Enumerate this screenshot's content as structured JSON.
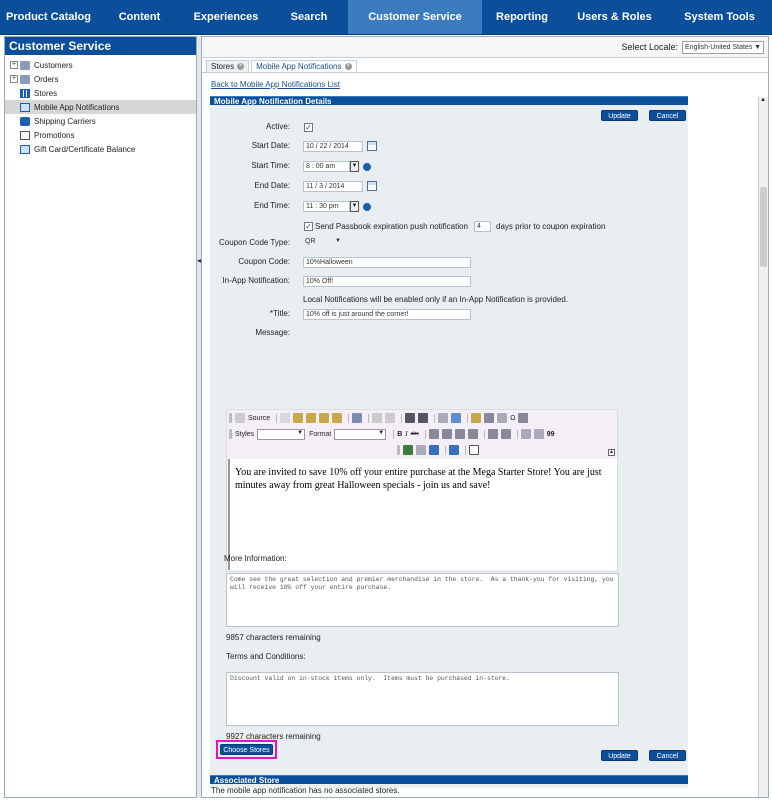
{
  "nav": {
    "items": [
      {
        "label": "Product Catalog"
      },
      {
        "label": "Content"
      },
      {
        "label": "Experiences"
      },
      {
        "label": "Search"
      },
      {
        "label": "Customer Service"
      },
      {
        "label": "Reporting"
      },
      {
        "label": "Users & Roles"
      },
      {
        "label": "System Tools"
      }
    ],
    "active": "Customer Service"
  },
  "sidebar": {
    "title": "Customer Service",
    "items": [
      {
        "label": "Customers",
        "icon": "folder-icon"
      },
      {
        "label": "Orders",
        "icon": "folder-icon"
      },
      {
        "label": "Stores",
        "icon": "store-icon"
      },
      {
        "label": "Mobile App Notifications",
        "icon": "mobile-icon"
      },
      {
        "label": "Shipping Carriers",
        "icon": "truck-icon"
      },
      {
        "label": "Promotions",
        "icon": "promotion-icon"
      },
      {
        "label": "Gift Card/Certificate Balance",
        "icon": "gift-card-icon"
      }
    ]
  },
  "locale": {
    "label": "Select Locale:",
    "value": "English-United States"
  },
  "tabs": [
    {
      "label": "Stores"
    },
    {
      "label": "Mobile App Notifications"
    }
  ],
  "back_link": "Back to Mobile App Notifications List",
  "details": {
    "title": "Mobile App Notification Details",
    "update": "Update",
    "cancel": "Cancel",
    "active_label": "Active:",
    "active_checked": "✓",
    "start_date_label": "Start Date:",
    "start_date": "10 / 22 / 2014",
    "start_time_label": "Start Time:",
    "start_time": "8 : 00  am",
    "end_date_label": "End Date:",
    "end_date": "11 / 3 / 2014",
    "end_time_label": "End Time:",
    "end_time": "11 : 30  pm",
    "passbook_label": "Send Passbook expiration push notification",
    "passbook_days": "4",
    "passbook_suffix": "days prior to coupon expiration",
    "coupon_type_label": "Coupon Code Type:",
    "coupon_type": "QR",
    "coupon_code_label": "Coupon Code:",
    "coupon_code": "10%Halloween",
    "inapp_label": "In-App Notification:",
    "inapp_value": "10% Off!",
    "local_note": "Local Notifications will be enabled only if an In-App Notification is provided.",
    "title_label": "*Title:",
    "title_value": "10% off is just around the corner!",
    "message_label": "Message:",
    "message_text": "You are invited to save 10% off your entire purchase at the Mega Starter Store!  You are just minutes away from great Halloween specials - join us and save!",
    "more_info_label": "More Information:",
    "more_info_text": "Come see the great selection and premier merchandise in the store.  As a thank-you for visiting, you will receive 10% off your entire purchase.",
    "more_info_remaining": "9857 characters remaining",
    "terms_label": "Terms and Conditions:",
    "terms_text": "Discount valid on in-stock items only.  Items must be purchased in-store.",
    "terms_remaining": "9927  characters remaining"
  },
  "editor_toolbar": {
    "source": "Source",
    "styles": "Styles",
    "format": "Format",
    "bold": "B",
    "italic": "I",
    "strike": "abc",
    "omega": "Ω",
    "quote": "99"
  },
  "associated": {
    "title": "Associated Store",
    "choose": "Choose Stores",
    "none_text": "The mobile app notification has no associated stores."
  }
}
